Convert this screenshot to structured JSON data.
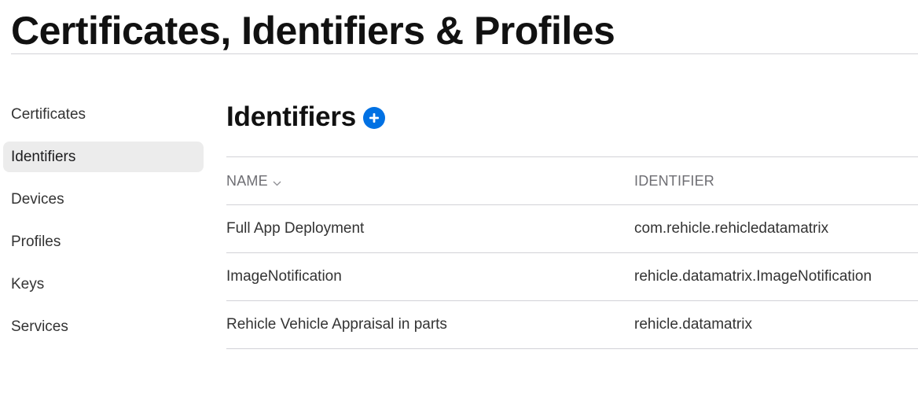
{
  "page": {
    "title": "Certificates, Identifiers & Profiles"
  },
  "sidebar": {
    "items": [
      {
        "label": "Certificates",
        "active": false
      },
      {
        "label": "Identifiers",
        "active": true
      },
      {
        "label": "Devices",
        "active": false
      },
      {
        "label": "Profiles",
        "active": false
      },
      {
        "label": "Keys",
        "active": false
      },
      {
        "label": "Services",
        "active": false
      }
    ]
  },
  "main": {
    "section_title": "Identifiers",
    "add_icon": "plus-circle-icon",
    "accent_color": "#0071e3",
    "table": {
      "columns": [
        {
          "label": "NAME",
          "sort_icon": "chevron-down-icon"
        },
        {
          "label": "IDENTIFIER"
        }
      ],
      "rows": [
        {
          "name": "Full App Deployment",
          "identifier": "com.rehicle.rehicledatamatrix"
        },
        {
          "name": "ImageNotification",
          "identifier": "rehicle.datamatrix.ImageNotification"
        },
        {
          "name": "Rehicle Vehicle Appraisal in parts",
          "identifier": "rehicle.datamatrix"
        }
      ]
    }
  }
}
